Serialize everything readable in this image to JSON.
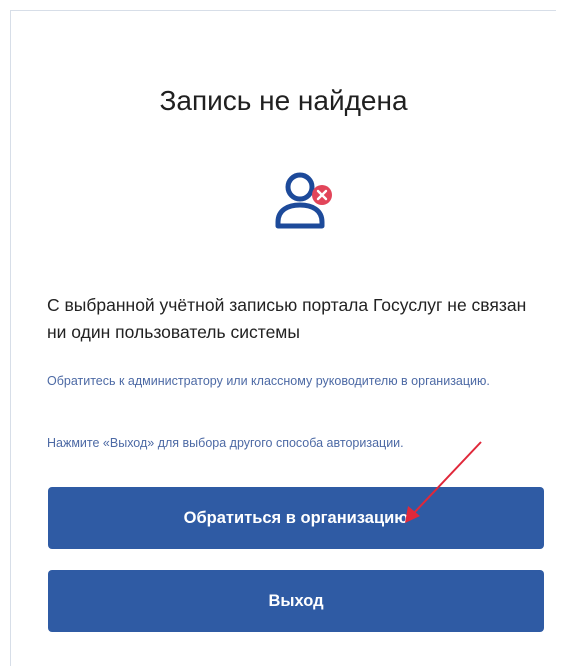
{
  "dialog": {
    "title": "Запись не найдена",
    "user_icon": "user-error-icon",
    "main_message": "С выбранной учётной записью портала Госуслуг не связан ни один пользователь системы",
    "hint_contact": "Обратитесь к администратору или классному руководителю в организацию.",
    "hint_exit": "Нажмите «Выход» для выбора другого способа авторизации.",
    "primary_button": "Обратиться в организацию",
    "secondary_button": "Выход"
  },
  "colors": {
    "button_bg": "#2f5ba4",
    "icon_blue": "#1d4a9a",
    "icon_error": "#e2455a",
    "annotation_arrow": "#e0283a",
    "hint_text": "#4d6aa5"
  }
}
